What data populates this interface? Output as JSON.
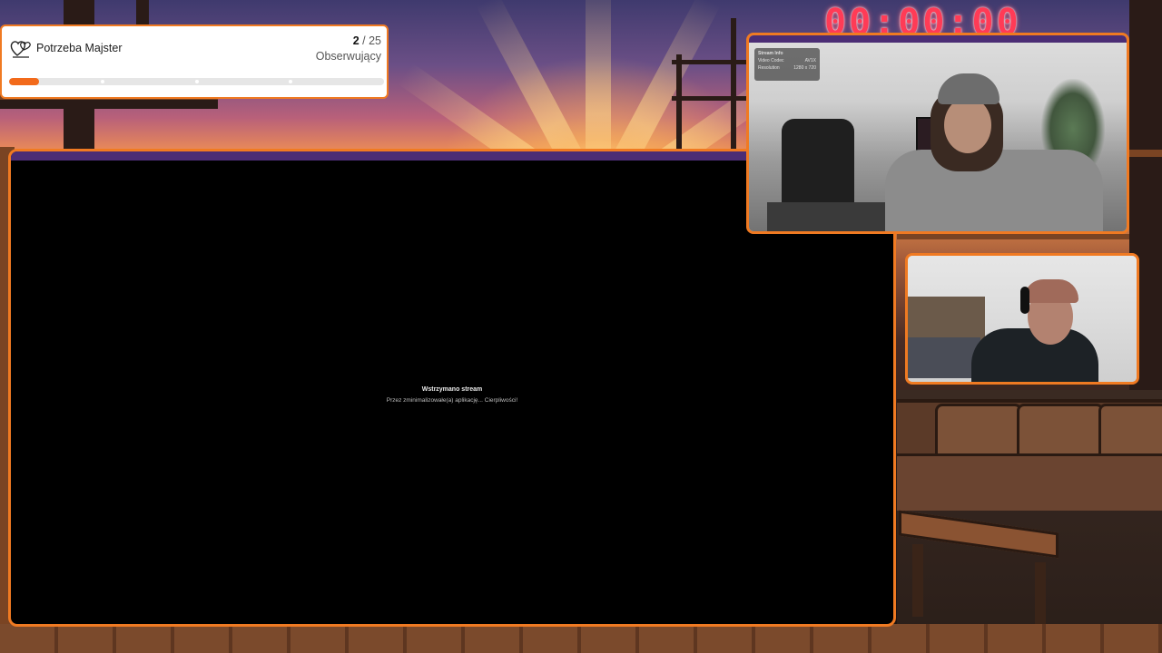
{
  "goal": {
    "icon": "hearts-icon",
    "title": "Potrzeba Majster",
    "current": "2",
    "separator": "/",
    "target": "25",
    "label": "Obserwujący",
    "progress_fraction": 0.08,
    "accent": "#f26a1b"
  },
  "timer": {
    "value": "00:00:00",
    "color": "#ff3b56"
  },
  "capture": {
    "paused_title": "Wstrzymano stream",
    "paused_subtitle": "Przez zminimalizowałe(a) aplikację... Cierpliwości!"
  },
  "cam1": {
    "info_title": "Stream Info",
    "info_rows": [
      {
        "label": "Video Codec",
        "value": "AV1X"
      },
      {
        "label": "Resolution",
        "value": "1280 x 720"
      }
    ]
  },
  "theme": {
    "frame_color": "#f07a22",
    "bar_color": "#4b2d75"
  }
}
